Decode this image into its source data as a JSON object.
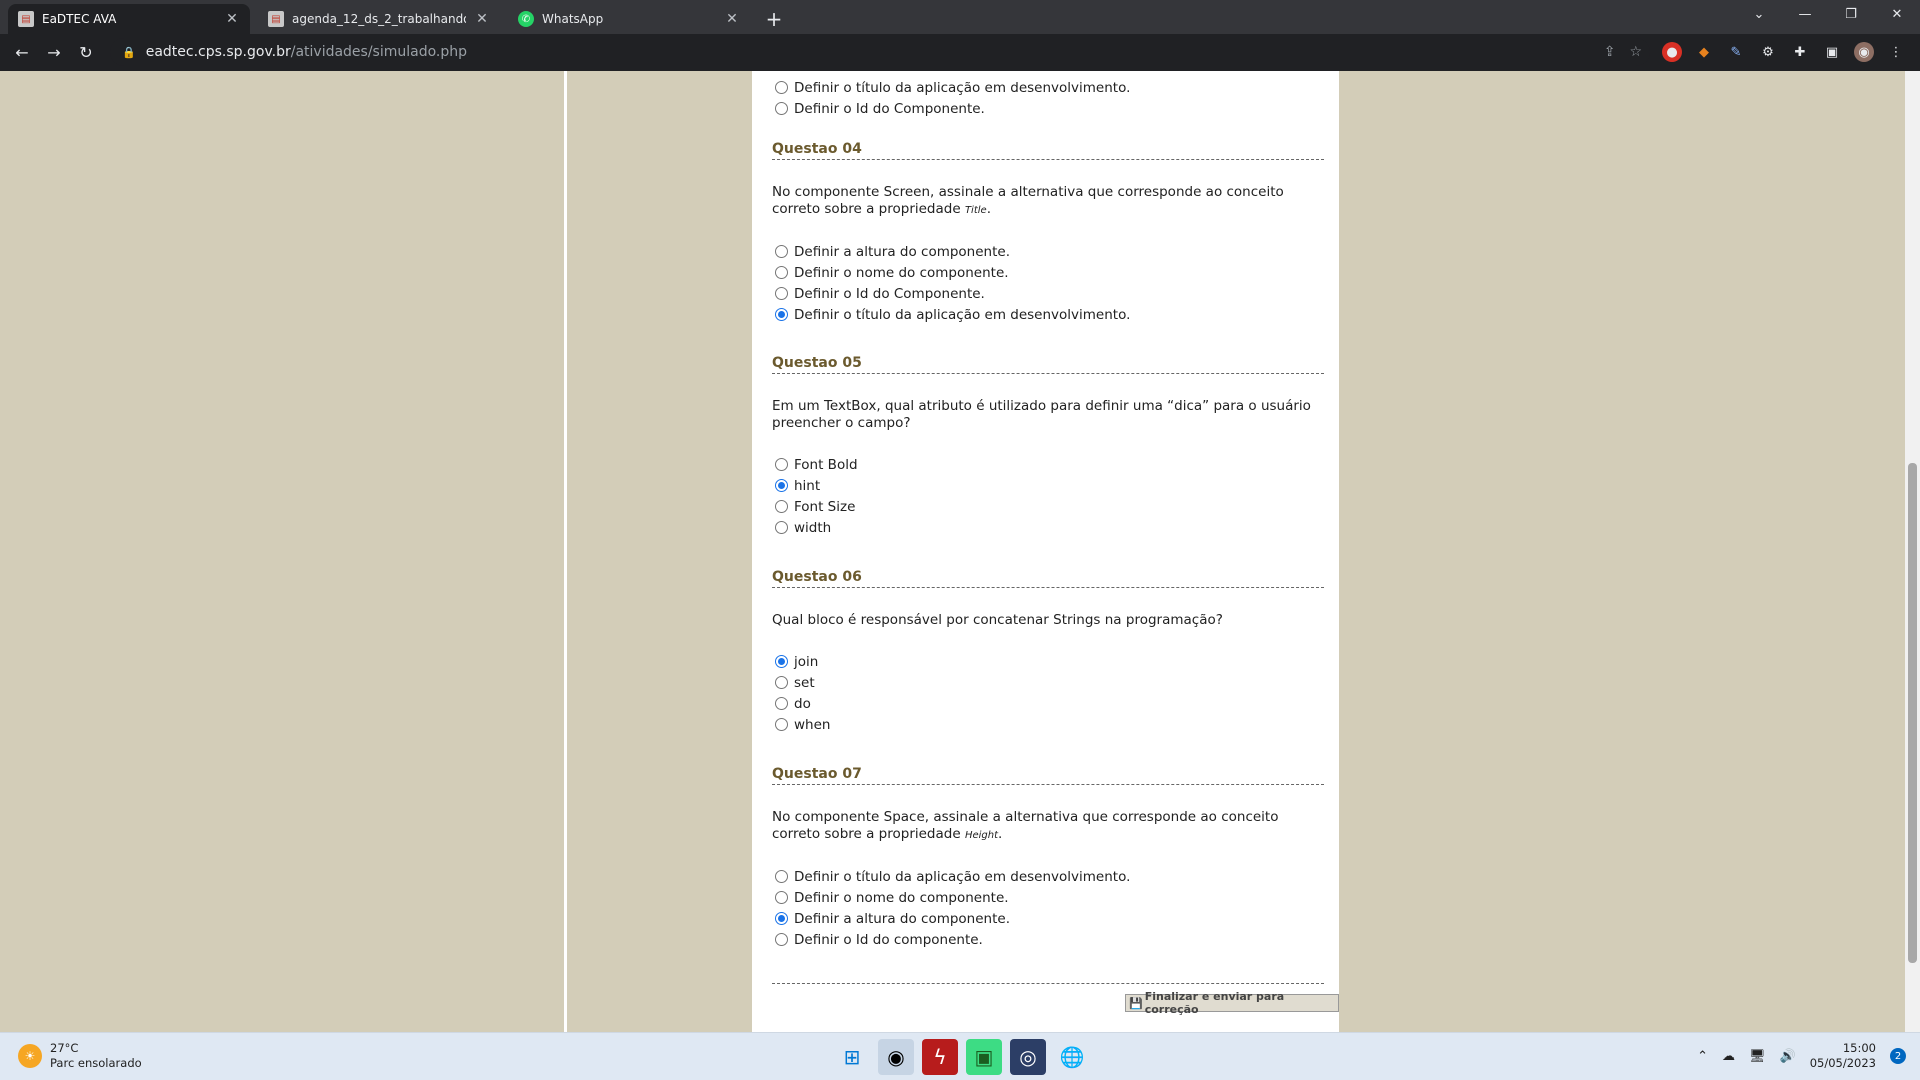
{
  "browser": {
    "tabs": [
      {
        "label": "EaDTEC AVA",
        "active": true
      },
      {
        "label": "agenda_12_ds_2_trabalhando_co",
        "active": false
      },
      {
        "label": "WhatsApp",
        "active": false
      }
    ],
    "url_host": "eadtec.cps.sp.gov.br",
    "url_path": "/atividades/simulado.php"
  },
  "top_options": [
    "Definir o título da aplicação em desenvolvimento.",
    "Definir o Id do Componente."
  ],
  "questions": [
    {
      "title": "Questao 04",
      "text": "No componente Screen, assinale a alternativa que corresponde ao conceito correto sobre a propriedade",
      "term": "Title",
      "options": [
        "Definir a altura do componente.",
        "Definir o nome do componente.",
        "Definir o Id do Componente.",
        "Definir o título da aplicação em desenvolvimento."
      ],
      "selected": 3
    },
    {
      "title": "Questao 05",
      "text": "Em um TextBox, qual atributo é utilizado para definir uma “dica” para o usuário preencher o campo?",
      "term": "",
      "options": [
        "Font Bold",
        "hint",
        "Font Size",
        "width"
      ],
      "selected": 1
    },
    {
      "title": "Questao 06",
      "text": "Qual bloco é responsável por concatenar Strings na programação?",
      "term": "",
      "options": [
        "join",
        "set",
        "do",
        "when"
      ],
      "selected": 0
    },
    {
      "title": "Questao 07",
      "text": "No componente Space, assinale a alternativa que corresponde ao conceito correto sobre a propriedade",
      "term": "Height",
      "options": [
        "Definir o título da aplicação em desenvolvimento.",
        "Definir o nome do componente.",
        "Definir a altura do componente.",
        "Definir o Id do componente."
      ],
      "selected": 2
    }
  ],
  "submit_label": "Finalizar e enviar para correção",
  "taskbar": {
    "temperature": "27°C",
    "weather": "Parc ensolarado",
    "time": "15:00",
    "date": "05/05/2023",
    "notifications": "2"
  }
}
